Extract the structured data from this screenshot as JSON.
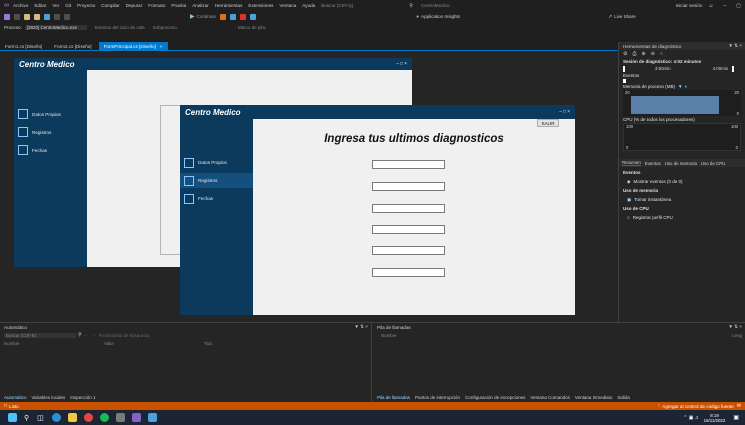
{
  "menu": {
    "items": [
      "Archivo",
      "Editar",
      "Ver",
      "Git",
      "Proyecto",
      "Compilar",
      "Depurar",
      "Formato",
      "Prueba",
      "Analizar",
      "Herramientas",
      "Extensiones",
      "Ventana",
      "Ayuda"
    ],
    "search": "Buscar (Ctrl+Q)",
    "solution": "CentroMedico",
    "signin": "Iniciar sesión",
    "liveshare": "Live Share"
  },
  "toolbar": {
    "continue": "Continuar",
    "app_insights": "Application Insights"
  },
  "process": {
    "label": "Proceso:",
    "value": "[3920] CentroMedico.exe",
    "events": "Eventos del ciclo de vida",
    "thread": "Subproceso:",
    "stackframe": "Marco de pila:"
  },
  "doc_tabs": [
    {
      "label": "Form1.cs [Diseño]"
    },
    {
      "label": "Form2.cs [Diseño]"
    },
    {
      "label": "FormPrincipal.cs [Diseño]"
    }
  ],
  "back_form": {
    "title": "Centro Medico",
    "side_items": [
      "Datos Propios",
      "Registros",
      "Fechas"
    ]
  },
  "front_form": {
    "title": "Centro Medico",
    "salir": "SALIR",
    "heading": "Ingresa tus ultimos diagnosticos",
    "side_items": [
      "Datos Propios",
      "Registros",
      "Fechas"
    ],
    "textbox_count": 6
  },
  "diagnostics": {
    "title": "Herramientas de diagnóstico",
    "session": "Sesión de diagnóstico: 4:02 minutos",
    "time_a": "3:50min",
    "time_b": "4:00min",
    "events": "Eventos",
    "memory": "Memoria de proceso (MB)",
    "memory_max": "20",
    "memory_min": "0",
    "cpu": "CPU (% de todos los procesadores)",
    "cpu_max": "100",
    "cpu_min": "0",
    "tabs": [
      "Resumen",
      "Eventos",
      "Uso de memoria",
      "Uso de CPU"
    ],
    "events_head": "Eventos",
    "show_events": "Mostrar eventos (0 de 0)",
    "mem_head": "Uso de memoria",
    "snapshot": "Tomar instantánea",
    "cpu_head": "Uso de CPU",
    "cpu_profile": "Registrar perfil CPU"
  },
  "autos": {
    "title": "Automático",
    "search": "Buscar (Ctrl+E)",
    "depth": "Profundidad de búsqueda:",
    "col_name": "Nombre",
    "col_value": "Valor",
    "col_type": "Tipo",
    "tabs": [
      "Automático",
      "Variables locales",
      "Inspección 1"
    ]
  },
  "callstack": {
    "title": "Pila de llamadas",
    "col_name": "Nombre",
    "col_lang": "Leng",
    "tabs": [
      "Pila de llamadas",
      "Puntos de interrupción",
      "Configuración de excepciones",
      "Ventana Comandos",
      "Ventana Inmediato",
      "Salida"
    ]
  },
  "status": {
    "left": "Listo",
    "right": "Agregar al control de código fuente"
  },
  "taskbar": {
    "time": "8:19",
    "date": "16/11/2022"
  },
  "colors": {
    "form_blue": "#0b3a5d",
    "accent": "#007acc",
    "status": "#ca5100"
  }
}
